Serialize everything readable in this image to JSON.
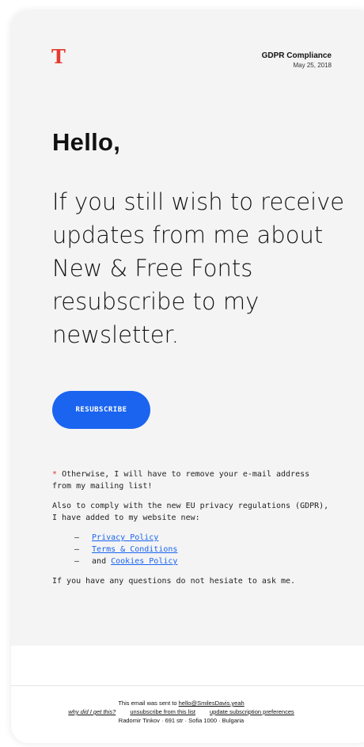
{
  "header": {
    "logo_letter": "T",
    "meta_title": "GDPR Compliance",
    "meta_date": "May 25, 2018"
  },
  "hero": {
    "greeting": "Hello,",
    "message": "If you still wish to receive updates from me about New & Free Fonts resubscribe to my newsletter."
  },
  "cta": {
    "label": "RESUBSCRIBE"
  },
  "body": {
    "note_star": "*",
    "note": "Otherwise, I will have to remove your e-mail address from my mailing list!",
    "intro": "Also to comply with the new EU privacy regulations (GDPR), I have added to my website new:",
    "list_dash": "—",
    "list_and": "and",
    "links": [
      "Privacy Policy",
      "Terms & Conditions",
      "Cookies Policy"
    ],
    "closing": "If you have any questions do not hesiate to ask me."
  },
  "footer": {
    "sent_to_prefix": "This email was sent to",
    "email": "hello@SmilesDavis.yeah",
    "why": "why did I get this?",
    "unsubscribe": "unsubscribe from this list",
    "preferences": "update subscription preferences",
    "address": "Radomir Tinkov · 691 str · Sofia 1000 · Bulgaria"
  },
  "colors": {
    "accent": "#1a64f0",
    "logo_red": "#e53a2d",
    "panel_bg": "#f4f4f4"
  }
}
